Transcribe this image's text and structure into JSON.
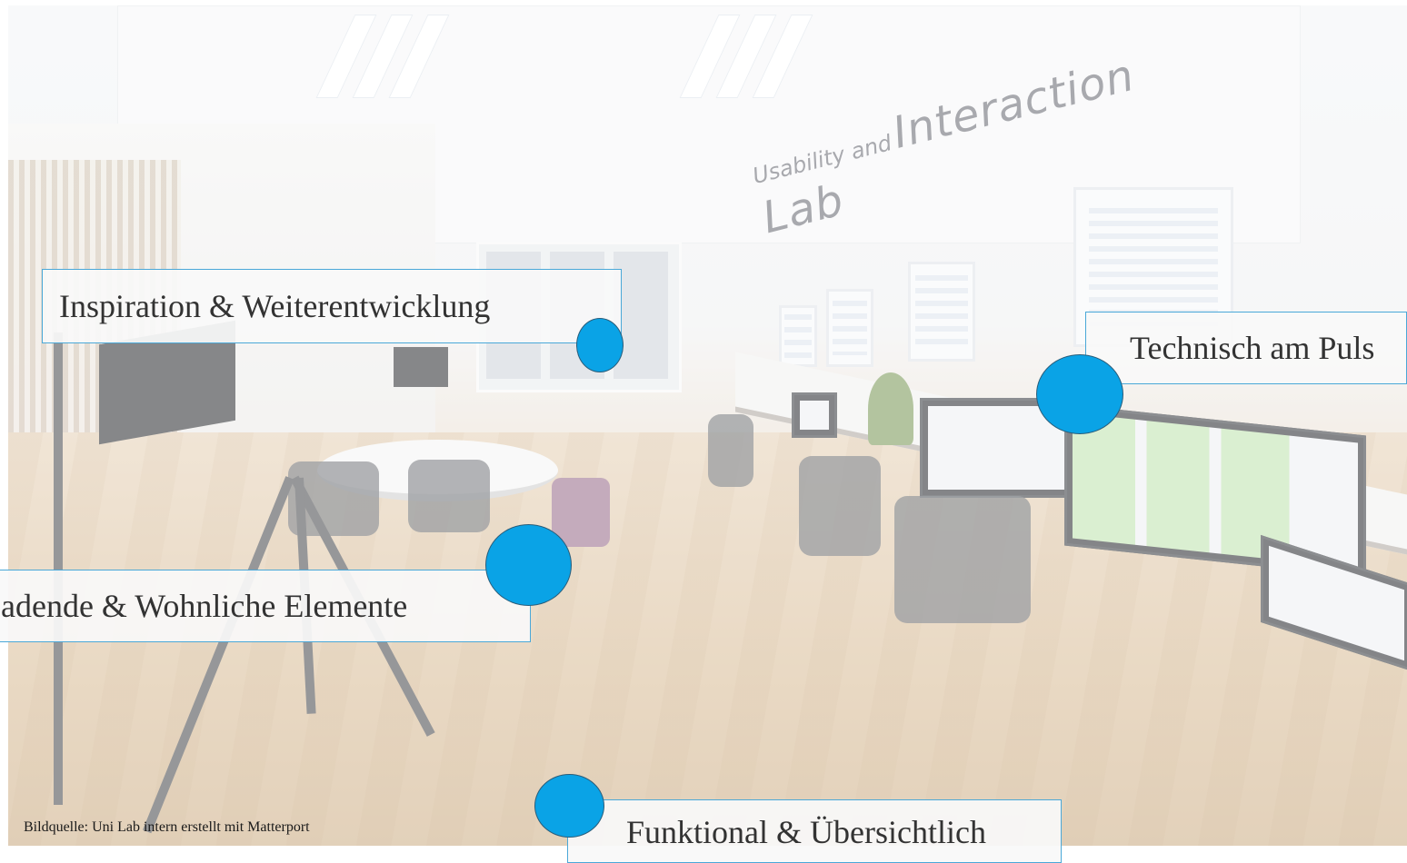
{
  "scene": {
    "wall_sign_small": "Usability and",
    "wall_sign_big": "Interaction Lab"
  },
  "callouts": [
    {
      "id": "inspiration",
      "label": "Inspiration & Weiterentwicklung"
    },
    {
      "id": "technisch",
      "label": "Technisch am Puls"
    },
    {
      "id": "einladend",
      "label": "adende & Wohnliche Elemente"
    },
    {
      "id": "funktional",
      "label": "Funktional & Übersichtlich"
    }
  ],
  "credit": "Bildquelle: Uni Lab intern erstellt mit Matterport",
  "colors": {
    "accent": "#0aa3e6",
    "callout_border": "#4aa8d8",
    "callout_text": "#333333"
  }
}
